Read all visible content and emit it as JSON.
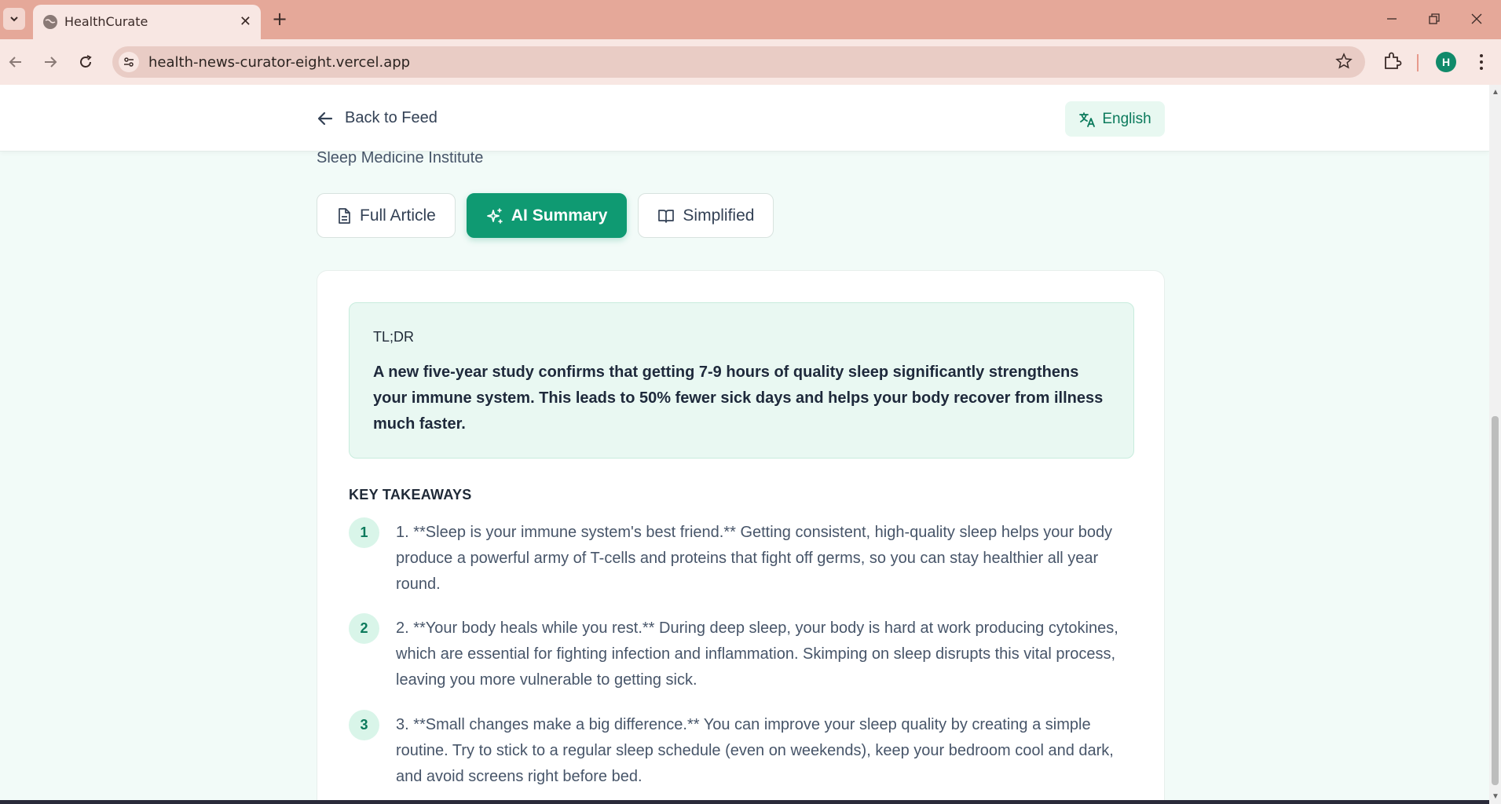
{
  "browser": {
    "tab_title": "HealthCurate",
    "url": "health-news-curator-eight.vercel.app",
    "profile_initial": "H"
  },
  "header": {
    "back_label": "Back to Feed",
    "language_label": "English"
  },
  "article": {
    "source": "Sleep Medicine Institute"
  },
  "view_tabs": [
    {
      "label": "Full Article",
      "icon": "document-icon",
      "active": false
    },
    {
      "label": "AI Summary",
      "icon": "sparkles-icon",
      "active": true
    },
    {
      "label": "Simplified",
      "icon": "book-open-icon",
      "active": false
    }
  ],
  "summary": {
    "tldr_label": "TL;DR",
    "tldr_text": "A new five-year study confirms that getting 7-9 hours of quality sleep significantly strengthens your immune system. This leads to 50% fewer sick days and helps your body recover from illness much faster.",
    "key_takeaways_label": "KEY TAKEAWAYS",
    "takeaways": [
      {
        "number": "1",
        "text": "1. **Sleep is your immune system's best friend.** Getting consistent, high-quality sleep helps your body produce a powerful army of T-cells and proteins that fight off germs, so you can stay healthier all year round."
      },
      {
        "number": "2",
        "text": "2. **Your body heals while you rest.** During deep sleep, your body is hard at work producing cytokines, which are essential for fighting infection and inflammation. Skimping on sleep disrupts this vital process, leaving you more vulnerable to getting sick."
      },
      {
        "number": "3",
        "text": "3. **Small changes make a big difference.** You can improve your sleep quality by creating a simple routine. Try to stick to a regular sleep schedule (even on weekends), keep your bedroom cool and dark, and avoid screens right before bed."
      }
    ]
  },
  "colors": {
    "accent": "#0f9a72",
    "accent_light": "#e9f8f2",
    "chrome": "#e5a899"
  }
}
